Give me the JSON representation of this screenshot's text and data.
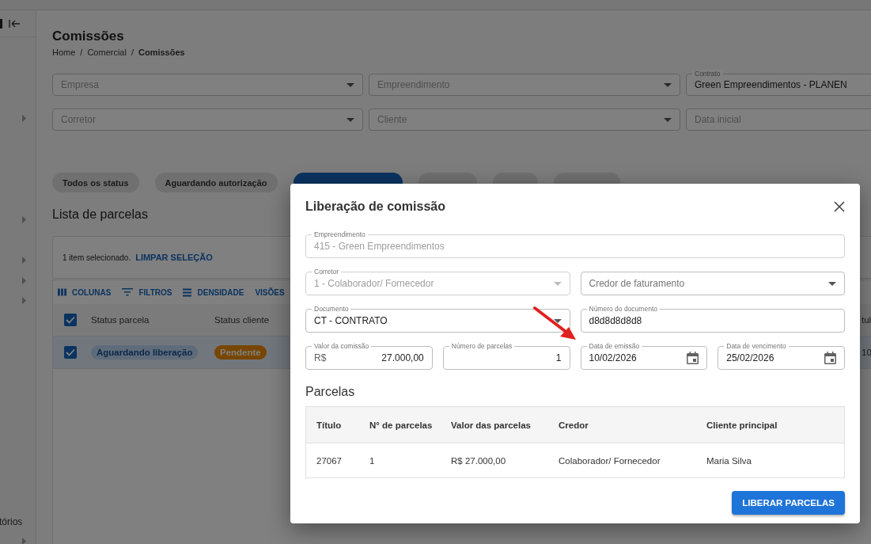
{
  "sidebar": {
    "items": [
      {
        "label": "tórios"
      }
    ]
  },
  "page": {
    "title": "Comissões",
    "breadcrumb": [
      {
        "kind": "link",
        "label": "Home"
      },
      {
        "kind": "separator",
        "label": "/"
      },
      {
        "kind": "link",
        "label": "Comercial"
      },
      {
        "kind": "separator",
        "label": "/"
      },
      {
        "kind": "current",
        "label": "Comissões"
      }
    ],
    "filters": [
      {
        "label": "Empresa",
        "kind": "select"
      },
      {
        "label": "Empreendimento",
        "kind": "select"
      },
      {
        "label": "Contrato",
        "kind": "text",
        "value": "Green Empreendimentos - PLANEN"
      },
      {
        "label": "Corretor",
        "kind": "select"
      },
      {
        "label": "Cliente",
        "kind": "select"
      },
      {
        "label": "Data inicial",
        "kind": "text"
      }
    ],
    "status_chips": [
      {
        "label": "Todos os status",
        "selected": false
      },
      {
        "label": "Aguardando autorização",
        "selected": false
      },
      {
        "selected": true
      },
      {
        "selected": false
      },
      {
        "selected": false
      },
      {
        "selected": false
      }
    ],
    "list_title": "Lista de parcelas",
    "selection_bar": {
      "text": "1 item selecionado.",
      "action": "LIMPAR SELEÇÃO"
    },
    "toolbar": [
      {
        "label": "COLUNAS",
        "kind": "columns"
      },
      {
        "label": "FILTROS",
        "kind": "filters"
      },
      {
        "label": "DENSIDADE",
        "kind": "density"
      },
      {
        "label": "VISÕES",
        "kind": "views"
      }
    ],
    "table": {
      "all_selected": true,
      "columns": [
        "Status parcela",
        "Status cliente",
        "tul"
      ],
      "rows": [
        {
          "selected": true,
          "status_parcela": {
            "label": "Aguardando liberação",
            "color": "#5e6b7a"
          },
          "status_cliente": {
            "label": "Pendente",
            "color": "#784600"
          },
          "column_3": "10"
        }
      ]
    }
  },
  "dialog": {
    "title": "Liberação de comissão",
    "fields": [
      {
        "label": "Empreendimento",
        "value": "415 - Green Empreendimentos",
        "kind": "text",
        "disabled": true
      },
      {
        "label": "Corretor",
        "value": "1 - Colaborador/ Fornecedor",
        "kind": "select",
        "disabled": true
      },
      {
        "label": "Credor de faturamento",
        "kind": "select",
        "disabled": false
      },
      {
        "label": "Documento",
        "value": "CT - CONTRATO",
        "kind": "select",
        "disabled": false
      },
      {
        "label": "Número do documento",
        "value": "d8d8d8d8d8",
        "kind": "text",
        "disabled": false
      },
      {
        "label": "Valor da comissão",
        "prefix": "R$",
        "value": "27.000,00",
        "kind": "number",
        "disabled": false
      },
      {
        "label": "Número de parcelas",
        "value": "1",
        "kind": "number",
        "disabled": false
      },
      {
        "label": "Data de emissão",
        "value": "10/02/2026",
        "kind": "date",
        "disabled": false
      },
      {
        "label": "Data de vencimento",
        "value": "25/02/2026",
        "kind": "date",
        "disabled": false
      }
    ],
    "section_title": "Parcelas",
    "table": {
      "columns": [
        "Título",
        "N° de parcelas",
        "Valor das parcelas",
        "Credor",
        "Cliente principal"
      ],
      "rows": [
        [
          "27067",
          "1",
          "R$ 27.000,00",
          "Colaborador/ Fornecedor",
          "Maria Silva"
        ]
      ]
    },
    "button": "LIBERAR PARCELAS"
  }
}
